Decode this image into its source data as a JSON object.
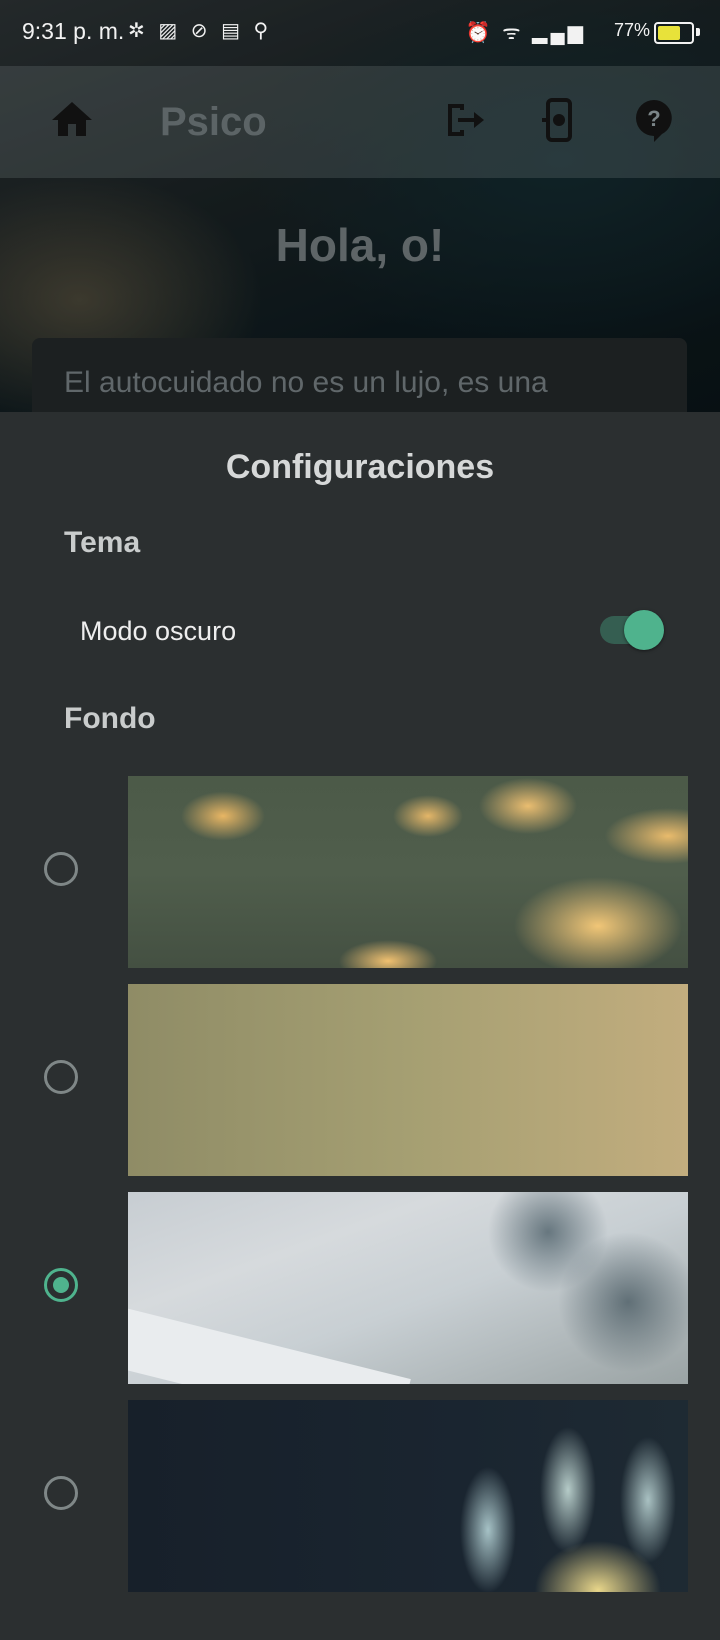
{
  "status_bar": {
    "time": "9:31 p. m.",
    "left_icons": "✲ ▨ ⊘ ▤ ⚲",
    "right_icons": "⏰ ᯤ ▂▄▆",
    "battery_percent": "77%",
    "battery_level": 0.77
  },
  "app_bar": {
    "title": "Psico",
    "icons": [
      "home-icon",
      "logout-icon",
      "device-settings-icon",
      "help-icon"
    ]
  },
  "home": {
    "greeting": "Hola, o!",
    "quote": "El autocuidado no es un lujo, es una"
  },
  "settings": {
    "title": "Configuraciones",
    "theme_heading": "Tema",
    "dark_mode_label": "Modo oscuro",
    "dark_mode_on": true,
    "background_heading": "Fondo",
    "background_options": [
      {
        "name": "clouds",
        "selected": false
      },
      {
        "name": "sand",
        "selected": false
      },
      {
        "name": "beach",
        "selected": true
      },
      {
        "name": "lotus",
        "selected": false
      }
    ]
  },
  "colors": {
    "accent": "#4fb38d",
    "sheet_background": "#2b2f30"
  }
}
